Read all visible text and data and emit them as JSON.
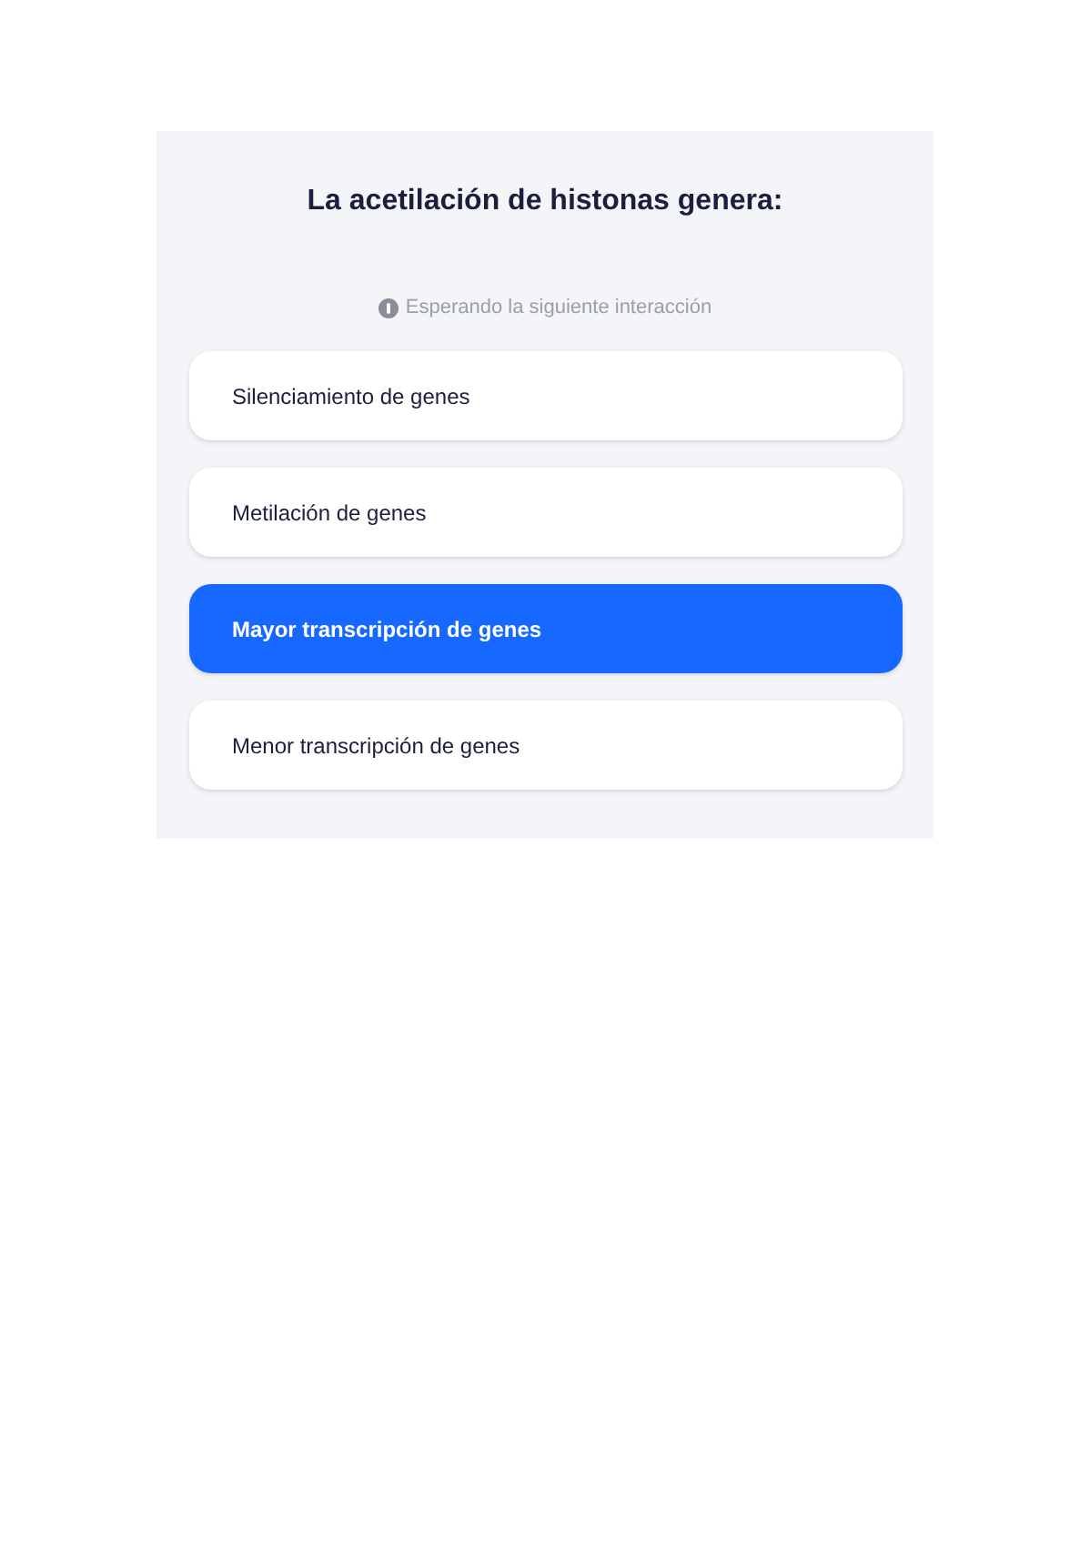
{
  "question": "La acetilación de histonas genera:",
  "status": "Esperando la siguiente interacción",
  "options": [
    {
      "label": "Silenciamiento de genes",
      "selected": false
    },
    {
      "label": "Metilación de genes",
      "selected": false
    },
    {
      "label": "Mayor transcripción de genes",
      "selected": true
    },
    {
      "label": "Menor transcripción de genes",
      "selected": false
    }
  ]
}
